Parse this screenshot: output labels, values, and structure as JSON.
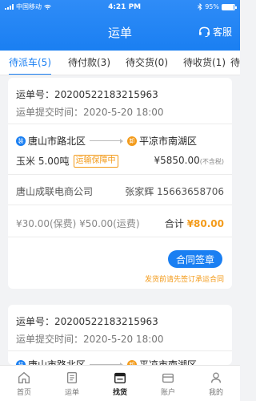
{
  "statusbar": {
    "carrier": "中国移动",
    "network": "",
    "time": "4:21 PM",
    "battery": "95%",
    "battery_level": 0.95
  },
  "header": {
    "title": "运单",
    "service_label": "客服"
  },
  "tabs": [
    {
      "label": "待派车(5)",
      "active": true
    },
    {
      "label": "待付款(3)",
      "active": false
    },
    {
      "label": "待交货(0)",
      "active": false
    },
    {
      "label": "待收货(1)",
      "active": false
    },
    {
      "label": "待",
      "active": false
    }
  ],
  "orders": [
    {
      "order_no": "运单号：20200522183215963",
      "submit_time_label": "运单提交时间：",
      "submit_time": "2020-5-20 18:00",
      "load_marker": "装",
      "from": "唐山市路北区",
      "unload_marker": "卸",
      "to": "平凉市南湖区",
      "goods": "玉米 5.00吨",
      "badge": "运输保障中",
      "price": "¥5850.00",
      "tax_note": "(不含税)",
      "company": "唐山成联电商公司",
      "contact": "张家辉 15663658706",
      "fees": "¥30.00(保费) ¥50.00(运费)",
      "total_label": "合计",
      "total": "¥80.00",
      "action_button": "合同签章",
      "note": "发货前请先签订承运合同"
    },
    {
      "order_no": "运单号：20200522183215963",
      "submit_time_label": "运单提交时间：",
      "submit_time": "2020-5-20 18:00",
      "load_marker": "装",
      "from": "唐山市路北区",
      "unload_marker": "卸",
      "to": "平凉市南湖区"
    }
  ],
  "bottom_nav": [
    {
      "label": "首页",
      "icon": "home-icon",
      "active": false
    },
    {
      "label": "运单",
      "icon": "waybill-icon",
      "active": false
    },
    {
      "label": "找货",
      "icon": "find-goods-icon",
      "active": true
    },
    {
      "label": "账户",
      "icon": "account-icon",
      "active": false
    },
    {
      "label": "我的",
      "icon": "profile-icon",
      "active": false
    }
  ],
  "colors": {
    "primary": "#1a7ff2",
    "accent": "#f39b1b"
  }
}
